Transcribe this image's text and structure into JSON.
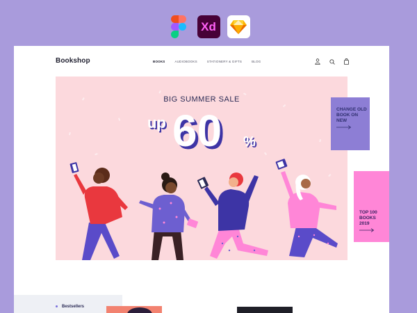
{
  "tools": [
    {
      "name": "figma",
      "label": ""
    },
    {
      "name": "xd",
      "label": "Xd"
    },
    {
      "name": "sketch",
      "label": ""
    }
  ],
  "brand": "Bookshop",
  "nav": {
    "items": [
      "BOOKS",
      "AUDIOBOOKS",
      "STATIONERY & GIFTS",
      "BLOG"
    ],
    "active_index": 0
  },
  "icons": [
    "user-icon",
    "search-icon",
    "cart-icon"
  ],
  "hero": {
    "title": "BIG SUMMER SALE",
    "prefix": "up",
    "amount": "60",
    "unit": "%"
  },
  "promos": [
    {
      "text": "CHANGE OLD BOOK ON NEW"
    },
    {
      "text": "TOP 100 BOOKS 2019"
    }
  ],
  "sidebar": {
    "item": "Bestsellers"
  },
  "colors": {
    "background": "#a99bdc",
    "hero": "#fcd9dd",
    "promo_purple": "#8d7ed5",
    "promo_pink": "#ff86d7",
    "navy": "#2b2b55",
    "accent": "#5a4bc9"
  }
}
